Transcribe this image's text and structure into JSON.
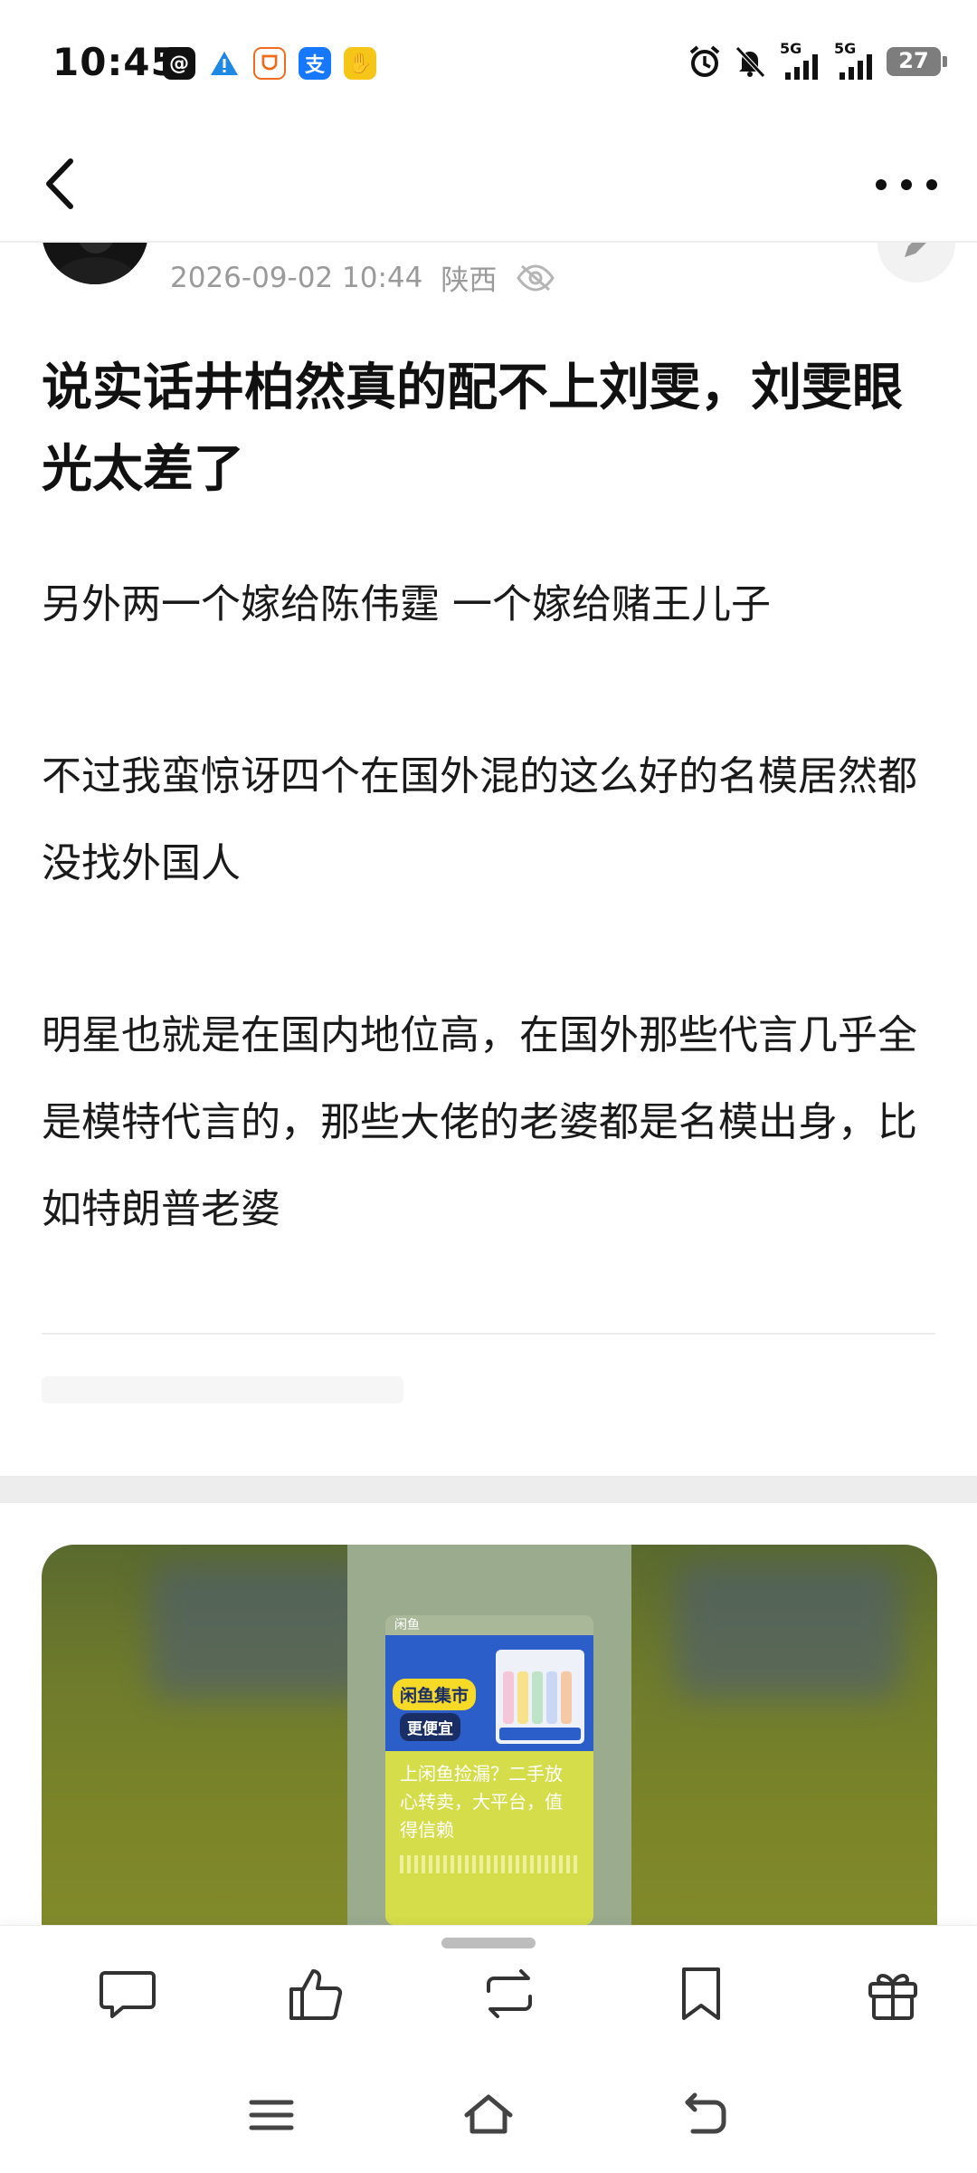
{
  "status_bar": {
    "time": "10:45",
    "app_icons": [
      "threads-icon",
      "warning-icon",
      "taobao-icon",
      "alipay-icon",
      "wallet-icon"
    ],
    "right_icons": [
      "alarm-icon",
      "mute-icon",
      "5g-signal-icon",
      "5g-signal-icon"
    ],
    "network_label_1": "5G",
    "network_label_2": "5G",
    "battery": "27"
  },
  "nav": {
    "back_icon": "back-arrow-icon",
    "more_icon": "more-dots-icon"
  },
  "post": {
    "date": "2026-09-02 10:44",
    "location": "陕西",
    "visibility_icon": "eye-hidden-icon",
    "title": "说实话井柏然真的配不上刘雯，刘雯眼光太差了",
    "paragraphs": [
      "另外两一个嫁给陈伟霆 一个嫁给赌王儿子",
      "不过我蛮惊讶四个在国外混的这么好的名模居然都没找外国人",
      "明星也就是在国内地位高，在国外那些代言几乎全是模特代言的，那些大佬的老婆都是名模出身，比如特朗普老婆"
    ]
  },
  "ad": {
    "brand": "闲鱼",
    "badge_main": "闲鱼集市",
    "badge_sub": "更便宜",
    "text": "上闲鱼捡漏？二手放心转卖，大平台，值得信赖",
    "colors": {
      "banner": "#2c5ec9",
      "card": "#d6dd4a",
      "accent": "#f7d928"
    }
  },
  "actions": [
    "comment-icon",
    "like-icon",
    "repost-icon",
    "bookmark-icon",
    "gift-icon"
  ],
  "system_nav": [
    "menu-icon",
    "home-icon",
    "back-icon"
  ]
}
